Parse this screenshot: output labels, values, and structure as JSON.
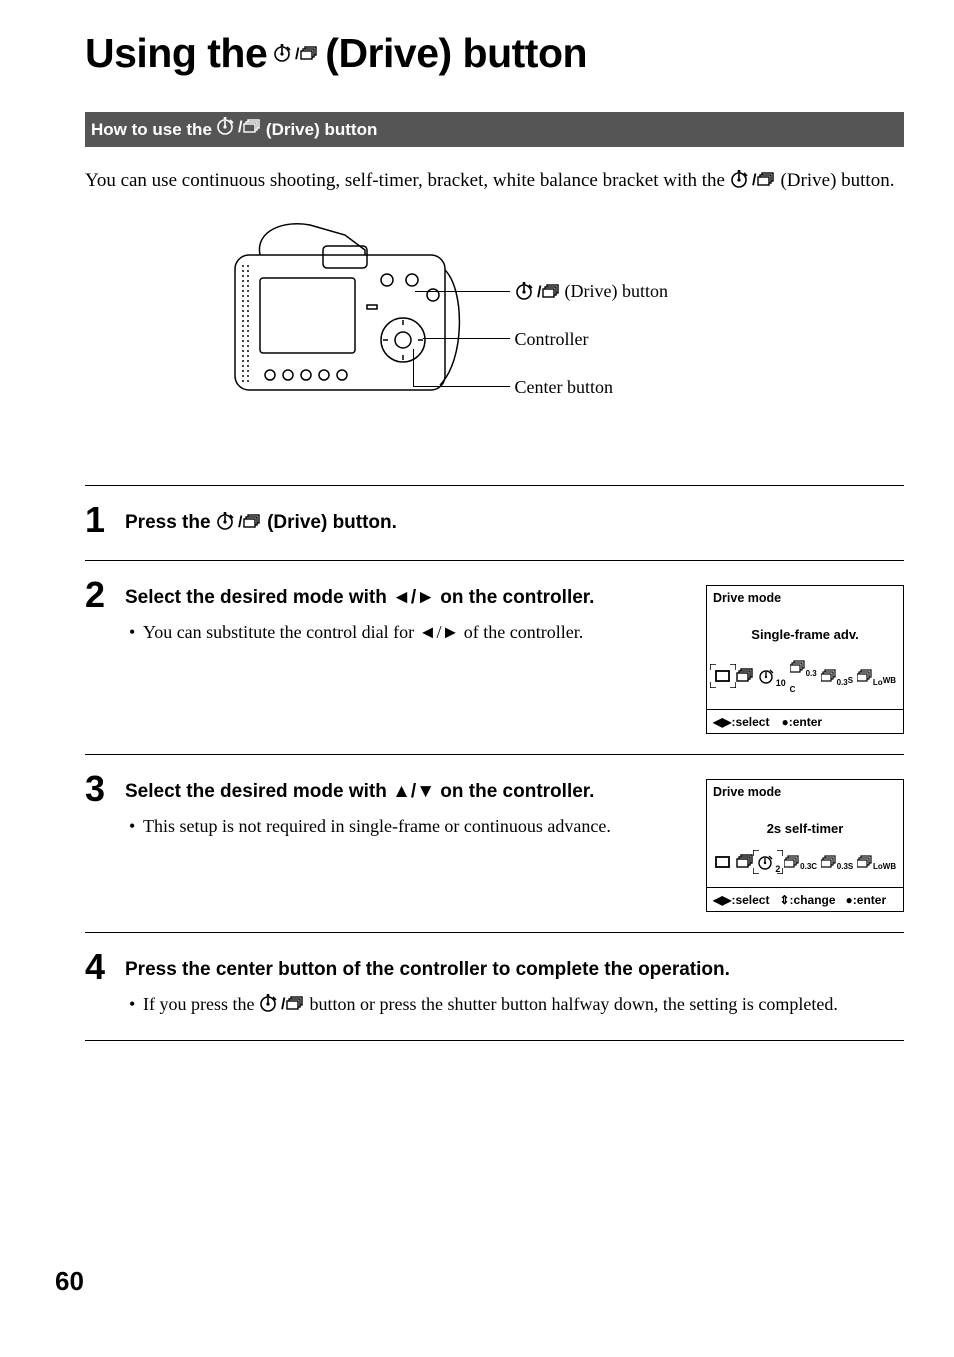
{
  "title_part1": "Using the ",
  "title_part2": " (Drive) button",
  "subhead_part1": "How to use the ",
  "subhead_part2": " (Drive) button",
  "intro_part1": "You can use continuous shooting, self-timer, bracket, white balance bracket with the ",
  "intro_part2": " (Drive) button.",
  "camera_labels": {
    "drive": " (Drive) button",
    "controller": "Controller",
    "center": "Center button"
  },
  "steps": [
    {
      "num": "1",
      "heading_a": "Press the ",
      "heading_b": " (Drive) button."
    },
    {
      "num": "2",
      "heading": "Select the desired mode with ◄/► on the controller.",
      "bullet": "You can substitute the control dial for ◄/► of the controller.",
      "screen": {
        "title": "Drive mode",
        "center": "Single-frame adv.",
        "footer_items": [
          "◀▶:select",
          "●:enter"
        ]
      }
    },
    {
      "num": "3",
      "heading": "Select the desired mode with ▲/▼ on the controller.",
      "bullet": "This setup is not required in single-frame or continuous advance.",
      "screen": {
        "title": "Drive mode",
        "center": "2s self-timer",
        "footer_items": [
          "◀▶:select",
          "⇕:change",
          "●:enter"
        ]
      }
    },
    {
      "num": "4",
      "heading": "Press the center button of the controller to complete the operation.",
      "bullet_a": "If you press the ",
      "bullet_b": " button or press the shutter button halfway down, the setting is completed."
    }
  ],
  "page_number": "60"
}
